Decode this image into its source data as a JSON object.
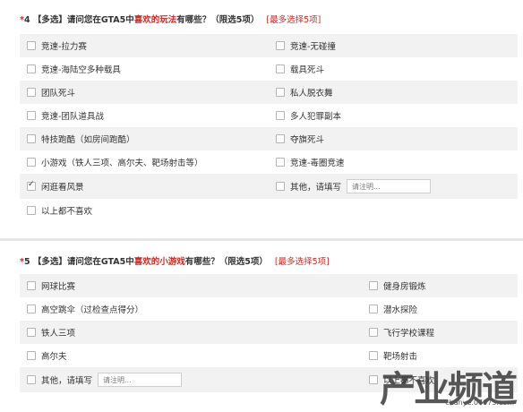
{
  "q4": {
    "number": "4",
    "type": "【多选】",
    "text_before": "请问您在GTA5中",
    "highlight": "喜欢的玩法",
    "text_after": "有哪些？（限选5项）",
    "max_label": "[最多选择5项]",
    "options": {
      "o1": "竞速-拉力赛",
      "o2": "竞速-无碰撞",
      "o3": "竞速-海陆空多种载具",
      "o4": "载具死斗",
      "o5": "团队死斗",
      "o6": "私人脱衣舞",
      "o7": "竞速-团队道具战",
      "o8": "多人犯罪副本",
      "o9": "特技跑酷（如房间跑酷）",
      "o10": "夺旗死斗",
      "o11": "小游戏（铁人三项、高尔夫、靶场射击等）",
      "o12": "竞速-毒圈竞速",
      "o13": "闲逛看风景",
      "o14": "其他，请填写",
      "o15": "以上都不喜欢"
    },
    "other_placeholder": "请注明..."
  },
  "q5": {
    "number": "5",
    "type": "【多选】",
    "text_before": "请问您在GTA5中",
    "highlight": "喜欢的小游戏",
    "text_after": "有哪些？（限选5项）",
    "max_label": "[最多选择5项]",
    "options": {
      "o1": "网球比赛",
      "o2": "健身房锻炼",
      "o3": "高空跳伞（过检查点得分）",
      "o4": "潜水探险",
      "o5": "铁人三项",
      "o6": "飞行学校课程",
      "o7": "高尔夫",
      "o8": "靶场射击",
      "o9": "其他，请填写",
      "o10": "以上都不喜欢"
    },
    "other_placeholder": "请注明..."
  },
  "watermark": {
    "big": "产业频道",
    "small": "chanye.07073.com"
  }
}
